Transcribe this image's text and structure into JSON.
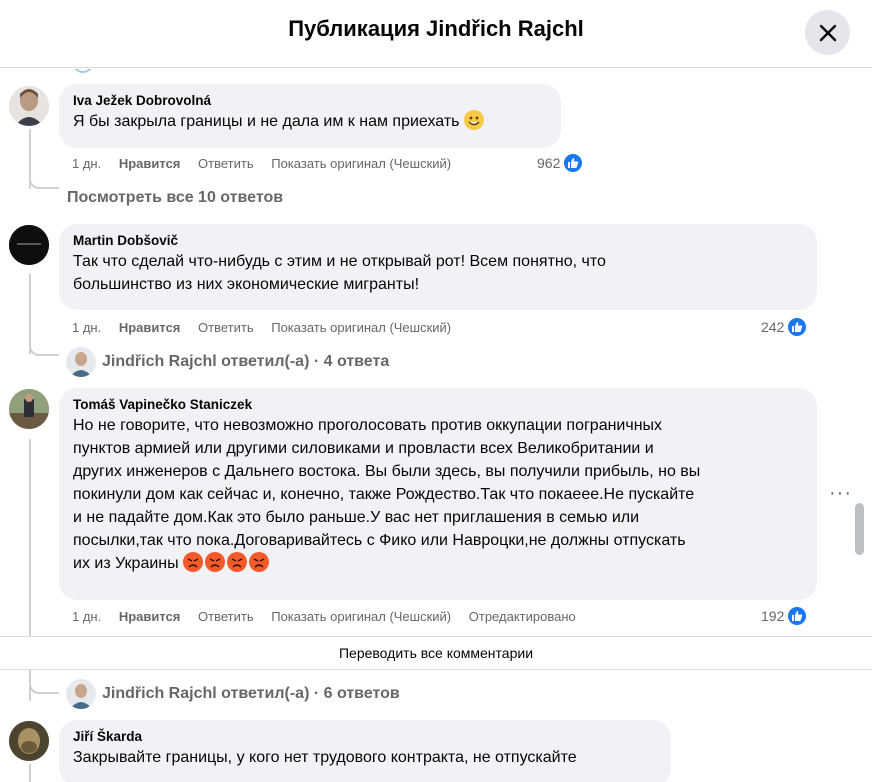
{
  "header": {
    "title": "Публикация Jindřich Rajchl"
  },
  "comments": [
    {
      "author": "Iva Ježek Dobrovolná",
      "text": "Я бы закрыла границы и не дала им к нам приехать",
      "emoji": "grinning-smiling-emoji",
      "time": "1 дн.",
      "like": "Нравится",
      "reply": "Ответить",
      "show_original": "Показать оригинал (Чешский)",
      "reactions": "962"
    },
    {
      "author": "Martin Dobšovič",
      "text_lines": [
        "Так что сделай что-нибудь с этим и не открывай рот! Всем понятно, что",
        "большинство из них экономические мигранты!"
      ],
      "time": "1 дн.",
      "like": "Нравится",
      "reply": "Ответить",
      "show_original": "Показать оригинал (Чешский)",
      "reactions": "242"
    },
    {
      "author": "Tomáš Vapinečko Staniczek",
      "text_lines": [
        "Но не говорите, что невозможно проголосовать против оккупации пограничных",
        "пунктов армией или другими силовиками и провласти всех Великобритании и",
        "других инженеров с Дальнего востока. Вы были здесь, вы получили прибыль, но вы",
        "покинули дом как сейчас и, конечно, также Рождество.Так что покаеее.Не пускайте",
        "и не падайте дом.Как это было раньше.У вас нет приглашения в семью или",
        "посылки,так что пока.Договаривайтесь с Фико или Навроцки,не должны отпускать",
        "их из Украины"
      ],
      "emoji": "angry-face-emoji",
      "time": "1 дн.",
      "like": "Нравится",
      "reply": "Ответить",
      "show_original": "Показать оригинал (Чешский)",
      "edited": "Отредактировано",
      "reactions": "192"
    },
    {
      "author": "Jiří Škarda",
      "text": "Закрывайте границы, у кого нет трудового контракта, не отпускайте"
    }
  ],
  "view_all_replies": "Посмотреть все 10 ответов",
  "reply_thread_1": {
    "name": "Jindřich Rajchl",
    "text": "ответил(-а) · 4 ответа"
  },
  "reply_thread_2": {
    "name": "Jindřich Rajchl",
    "text": "ответил(-а) · 6 ответов"
  },
  "translate_all": "Переводить все комментарии",
  "more_options": "···",
  "colors": {
    "accent": "#1877f2",
    "bubble": "#f0f2f5",
    "muted": "#65676b",
    "divider": "#dadde1"
  }
}
